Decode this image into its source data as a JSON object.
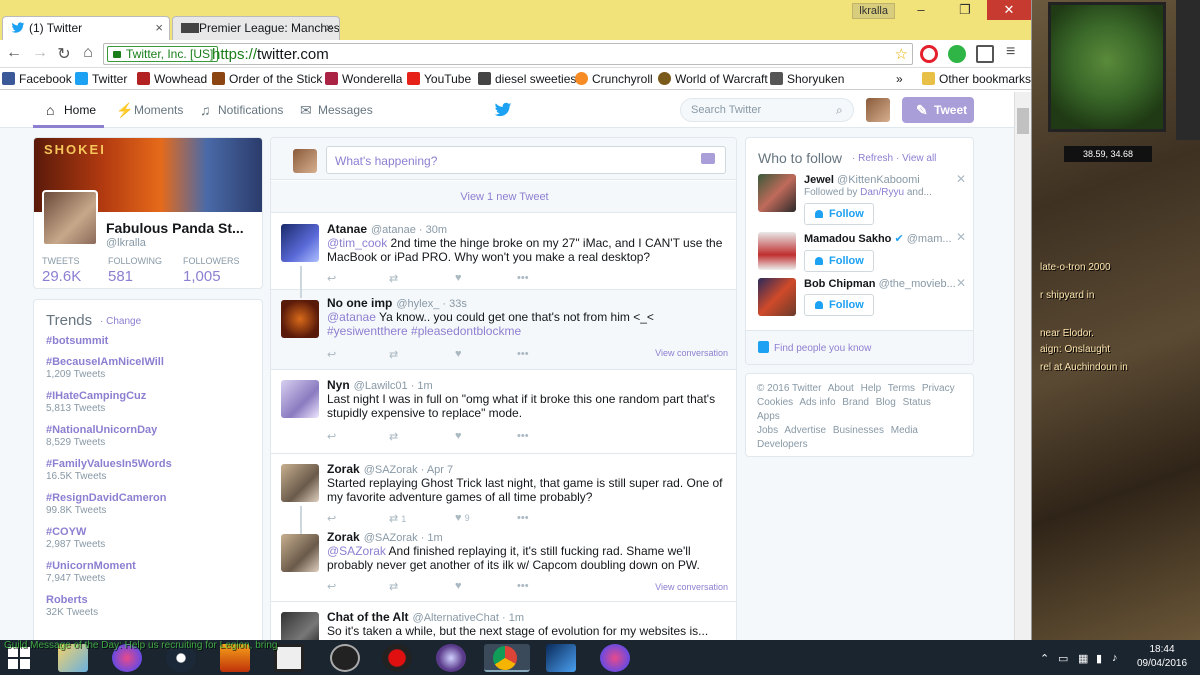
{
  "browser": {
    "tabs": [
      {
        "label": "(1) Twitter",
        "active": true
      },
      {
        "label": "Premier League: Manches",
        "active": false
      }
    ],
    "window_user": "lkralla",
    "security_badge": "Twitter, Inc. [US]",
    "url_scheme": "https://",
    "url_host": "twitter.com",
    "bookmarks": [
      {
        "label": "Facebook",
        "color": "#3b5998"
      },
      {
        "label": "Twitter",
        "color": "#1da1f2"
      },
      {
        "label": "Wowhead",
        "color": "#b22222"
      },
      {
        "label": "Order of the Stick",
        "color": "#8b4513"
      },
      {
        "label": "Wonderella",
        "color": "#aa2244"
      },
      {
        "label": "YouTube",
        "color": "#e62117"
      },
      {
        "label": "diesel sweeties",
        "color": "#444444"
      },
      {
        "label": "Crunchyroll",
        "color": "#f78c25"
      },
      {
        "label": "World of Warcraft",
        "color": "#7a5a1a"
      },
      {
        "label": "Shoryuken",
        "color": "#555555"
      }
    ],
    "bookmarks_overflow": "»",
    "other_bookmarks": "Other bookmarks"
  },
  "twitter": {
    "nav": {
      "home": "Home",
      "moments": "Moments",
      "notifications": "Notifications",
      "messages": "Messages",
      "search_placeholder": "Search Twitter",
      "tweet_button": "Tweet"
    },
    "profile": {
      "banner_text": "SHOKEI",
      "name": "Fabulous Panda St...",
      "handle": "@lkralla",
      "stats": [
        {
          "label": "TWEETS",
          "value": "29.6K"
        },
        {
          "label": "FOLLOWING",
          "value": "581"
        },
        {
          "label": "FOLLOWERS",
          "value": "1,005"
        }
      ]
    },
    "trends": {
      "title": "Trends",
      "change": "· Change",
      "items": [
        {
          "name": "#botsummit",
          "count": ""
        },
        {
          "name": "#BecauseIAmNiceIWill",
          "count": "1,209 Tweets"
        },
        {
          "name": "#IHateCampingCuz",
          "count": "5,813 Tweets"
        },
        {
          "name": "#NationalUnicornDay",
          "count": "8,529 Tweets"
        },
        {
          "name": "#FamilyValuesIn5Words",
          "count": "16.5K Tweets"
        },
        {
          "name": "#ResignDavidCameron",
          "count": "99.8K Tweets"
        },
        {
          "name": "#COYW",
          "count": "2,987 Tweets"
        },
        {
          "name": "#UnicornMoment",
          "count": "7,947 Tweets"
        },
        {
          "name": "Roberts",
          "count": "32K Tweets"
        }
      ]
    },
    "composer": {
      "placeholder": "What's happening?"
    },
    "new_tweets": "View 1 new Tweet",
    "tweets": [
      {
        "name": "Atanae",
        "meta": "@atanae · 30m",
        "pre": "@tim_cook",
        "text": " 2nd time the hinge broke on my 27\" iMac, and I CAN'T use the MacBook or iPad PRO. Why won't you make a real desktop?",
        "retweets": "",
        "likes": ""
      },
      {
        "name": "No one imp",
        "meta": "@hylex_ · 33s",
        "pre": "@atanae",
        "text": " Ya know.. you could get one that's not from him <_< ",
        "post": "#yesiwentthere #pleasedontblockme",
        "view_conversation": "View conversation"
      },
      {
        "name": "Nyn",
        "meta": "@Lawilc01 · 1m",
        "text": "Last night I was in full on \"omg what if it broke this one random part that's stupidly expensive to replace\" mode."
      },
      {
        "name": "Zorak",
        "meta": "@SAZorak · Apr 7",
        "text": "Started replaying Ghost Trick last night, that game is still super rad. One of my favorite adventure games of all time probably?",
        "retweets": "1",
        "likes": "9"
      },
      {
        "name": "Zorak",
        "meta": "@SAZorak · 1m",
        "pre": "@SAZorak",
        "text": " And finished replaying it, it's still fucking rad. Shame we'll probably never get another of its ilk w/ Capcom doubling down on PW.",
        "view_conversation": "View conversation"
      },
      {
        "name": "Chat of the Alt",
        "meta": "@AlternativeChat · 1m",
        "text": "So it's taken a while, but the next stage of evolution for my websites is..."
      }
    ],
    "who_to_follow": {
      "title": "Who to follow",
      "refresh": "· Refresh",
      "view_all": "· View all",
      "people": [
        {
          "name": "Jewel",
          "handle": "@KittenKaboomi",
          "sub_pre": "Followed by ",
          "sub_link": "Dan/Ryyu",
          "sub_post": " and...",
          "follow": "Follow"
        },
        {
          "name": "Mamadou Sakho",
          "handle": "@mam...",
          "follow": "Follow"
        },
        {
          "name": "Bob Chipman",
          "handle": "@the_movieb...",
          "follow": "Follow"
        }
      ],
      "find_people": "Find people you know"
    },
    "footer_links": [
      "© 2016 Twitter",
      "About",
      "Help",
      "Terms",
      "Privacy",
      "Cookies",
      "Ads info",
      "Brand",
      "Blog",
      "Status",
      "Apps",
      "Jobs",
      "Advertise",
      "Businesses",
      "Media",
      "Developers"
    ]
  },
  "game": {
    "coords": "38.59, 34.68",
    "lines": [
      "late-o-tron 2000",
      "r shipyard in",
      "near Elodor.",
      "aign: Onslaught",
      "rel at Auchindoun in"
    ],
    "guild_message": "Guild Message of the Day: Help us recruiting for Legion, bring"
  },
  "taskbar": {
    "time": "18:44",
    "date": "09/04/2016"
  }
}
